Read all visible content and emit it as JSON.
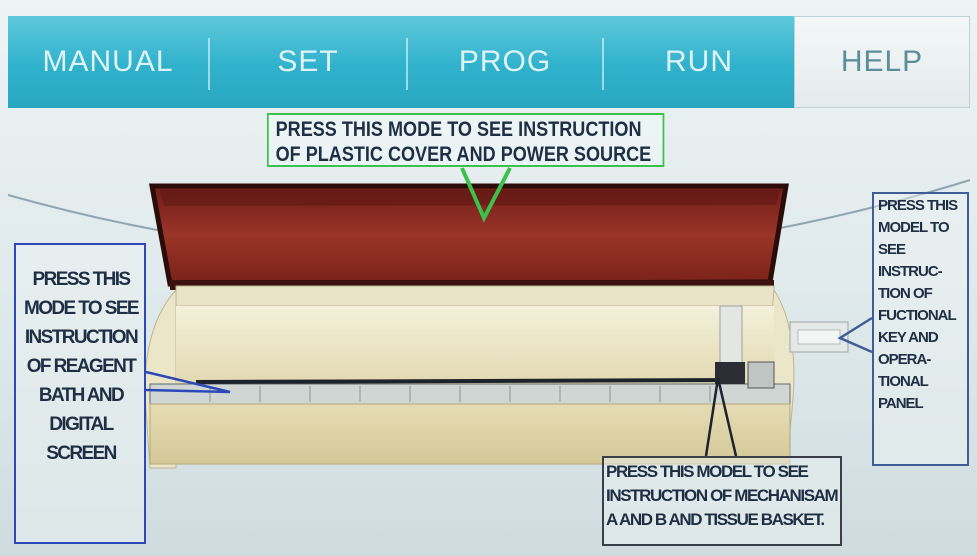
{
  "tabs": [
    {
      "label": "MANUAL",
      "active": false
    },
    {
      "label": "SET",
      "active": false
    },
    {
      "label": "PROG",
      "active": false
    },
    {
      "label": "RUN",
      "active": false
    },
    {
      "label": "HELP",
      "active": true
    }
  ],
  "callouts": {
    "cover_power": {
      "lines": [
        "PRESS THIS MODE TO SEE INSTRUCTION",
        "OF PLASTIC COVER AND POWER SOURCE"
      ],
      "color": "#3cc24c"
    },
    "reagent_bath": {
      "lines": [
        "PRESS THIS",
        "MODE TO SEE",
        "INSTRUCTION",
        "OF REAGENT",
        "BATH AND",
        "DIGITAL",
        "SCREEN"
      ],
      "color": "#2d49b8"
    },
    "functional_key": {
      "lines": [
        "PRESS THIS",
        "MODEL TO",
        "SEE",
        "INSTRUC-",
        "TION OF",
        "FUCTIONAL",
        "KEY AND",
        "OPERA-",
        "TIONAL",
        "PANEL"
      ],
      "color": "#3f5d96"
    },
    "mechanism": {
      "lines": [
        "PRESS THIS MODEL TO SEE",
        "INSTRUCTION OF MECHANISAM",
        "A AND B AND TISSUE BASKET."
      ],
      "color": "#3b3f4a"
    }
  },
  "colors": {
    "tab_bar": "#30b2cc",
    "cover": "#8e2b22",
    "body": "#e8e0bc"
  }
}
